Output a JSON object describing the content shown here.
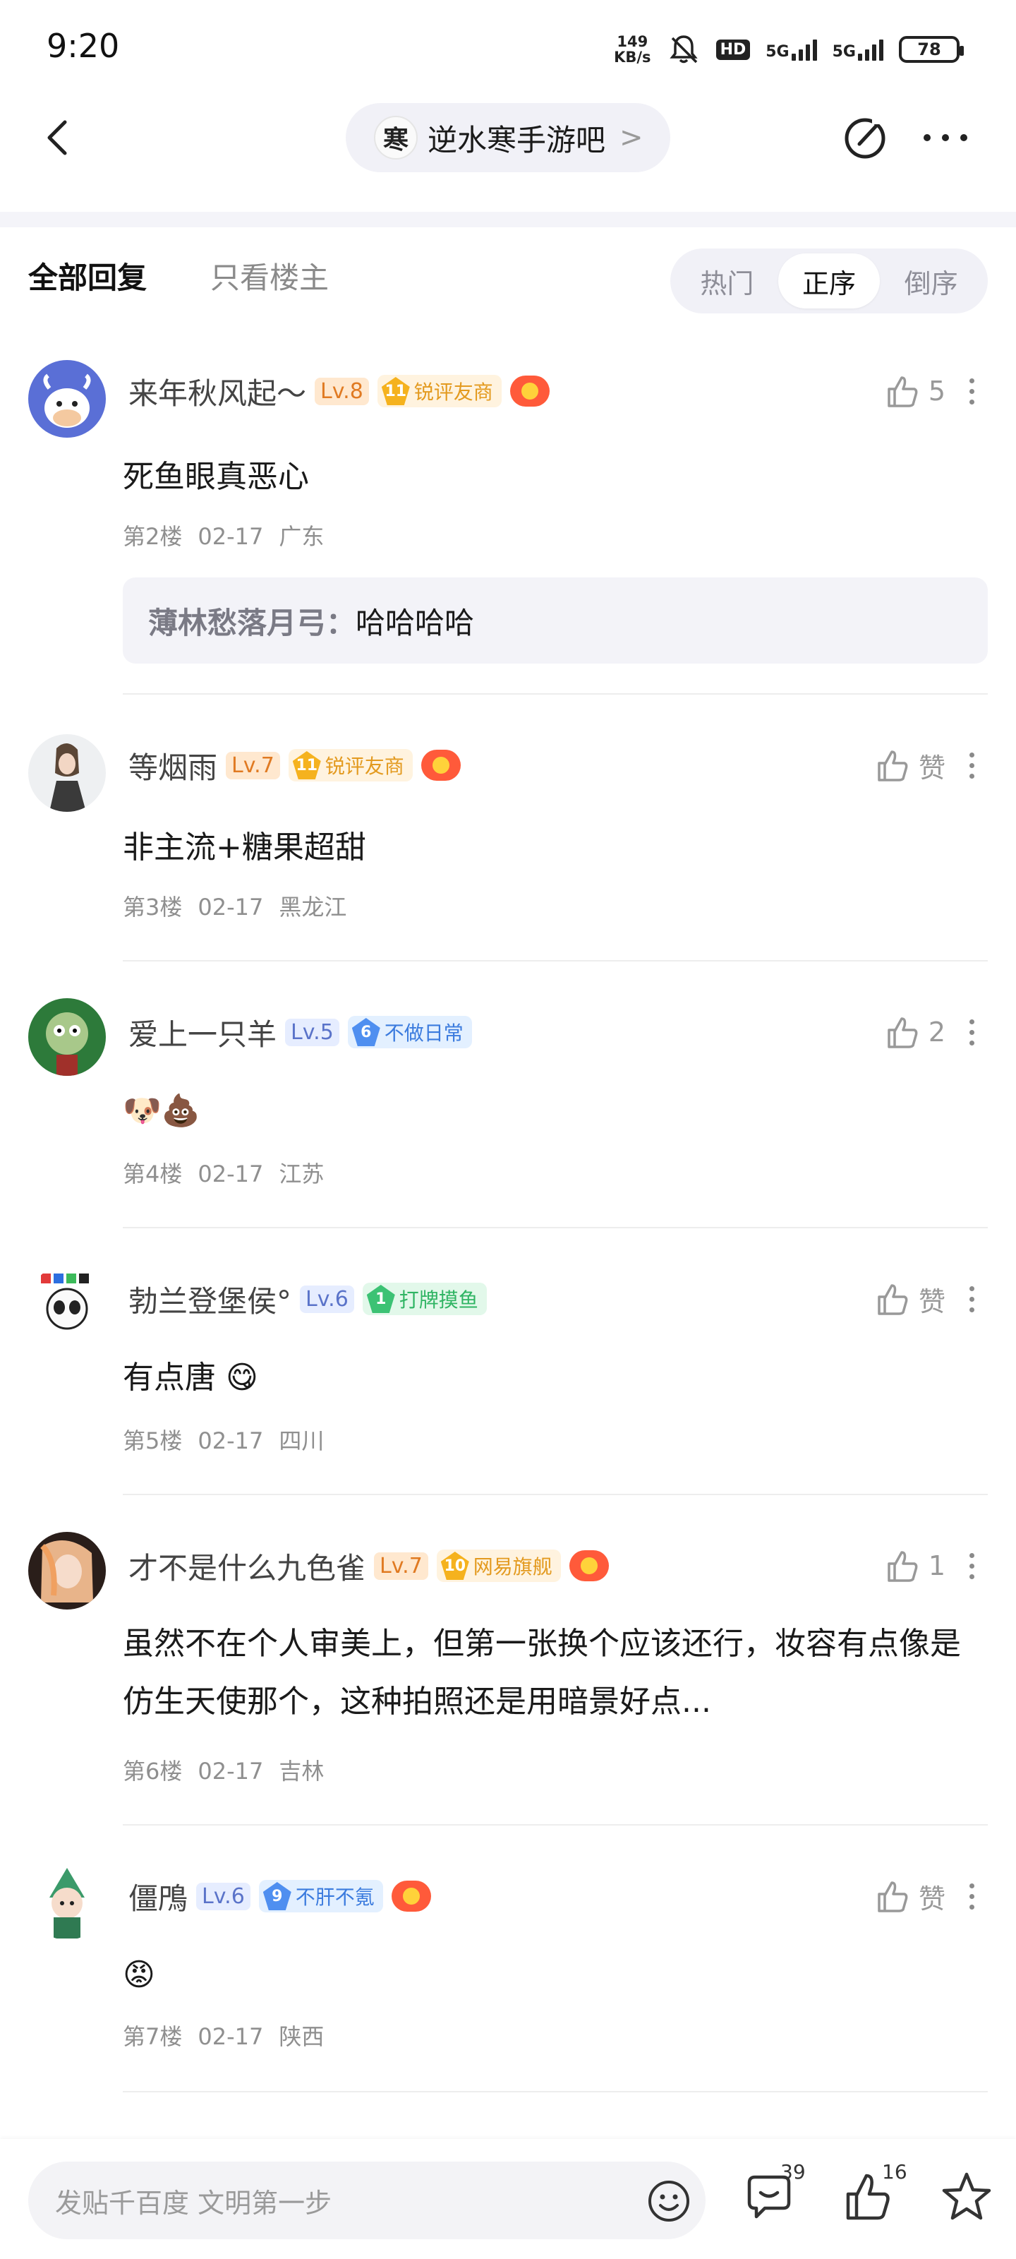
{
  "status": {
    "time": "9:20",
    "speed_value": "149",
    "speed_unit": "KB/s",
    "hd": "HD",
    "net1": "5G",
    "net2": "5G",
    "battery": "78"
  },
  "header": {
    "forum_name": "逆水寒手游吧",
    "forum_avatar_char": "寒",
    "chevron": ">"
  },
  "tabs": {
    "all": "全部回复",
    "owner_only": "只看楼主",
    "sort": [
      "热门",
      "正序",
      "倒序"
    ],
    "active_sort": "正序"
  },
  "comments": [
    {
      "username": "来年秋风起～",
      "level": "Lv.8",
      "badge_num": "11",
      "badge_text": "锐评友商",
      "likes": "5",
      "text": "死鱼眼真恶心",
      "floor": "第2楼",
      "date": "02-17",
      "location": "广东",
      "reply": {
        "name": "薄林愁落月弓",
        "colon": "：",
        "text": "哈哈哈哈"
      }
    },
    {
      "username": "等烟雨",
      "level": "Lv.7",
      "badge_num": "11",
      "badge_text": "锐评友商",
      "likes": "赞",
      "text": "非主流+糖果超甜",
      "floor": "第3楼",
      "date": "02-17",
      "location": "黑龙江"
    },
    {
      "username": "爱上一只羊",
      "level": "Lv.5",
      "badge_num": "6",
      "badge_text": "不做日常",
      "likes": "2",
      "text": "🐶💩",
      "floor": "第4楼",
      "date": "02-17",
      "location": "江苏"
    },
    {
      "username": "勃兰登堡侯°",
      "level": "Lv.6",
      "badge_num": "1",
      "badge_text": "打牌摸鱼",
      "likes": "赞",
      "text": "有点唐 😋",
      "floor": "第5楼",
      "date": "02-17",
      "location": "四川"
    },
    {
      "username": "才不是什么九色雀",
      "level": "Lv.7",
      "badge_num": "10",
      "badge_text": "网易旗舰",
      "likes": "1",
      "text": "虽然不在个人审美上，但第一张换个应该还行，妆容有点像是仿生天使那个，这种拍照还是用暗景好点...",
      "floor": "第6楼",
      "date": "02-17",
      "location": "吉林"
    },
    {
      "username": "僵鳲",
      "level": "Lv.6",
      "badge_num": "9",
      "badge_text": "不肝不氪",
      "likes": "赞",
      "text": "😡",
      "floor": "第7楼",
      "date": "02-17",
      "location": "陕西"
    }
  ],
  "bottom": {
    "placeholder": "发贴千百度 文明第一步",
    "comments_count": "39",
    "likes_count": "16"
  },
  "colors": {
    "accent_gold": "#f5b21e",
    "accent_blue": "#4f8ff0",
    "accent_green": "#3cc274",
    "pill_bg": "#f1f1f7"
  }
}
